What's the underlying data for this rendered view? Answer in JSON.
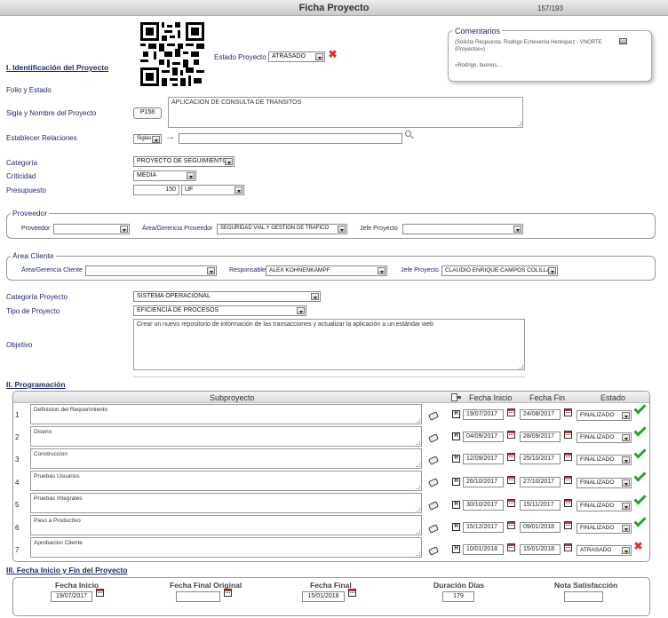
{
  "header": {
    "title": "Ficha Proyecto",
    "counter": "157/193"
  },
  "estado_proyecto": {
    "label": "Estado Proyecto",
    "value": "ATRASADO"
  },
  "comentarios": {
    "title": "Comentarios",
    "line1": "(Solicita Respuesta: Rodrigo Echeverria Henriquez - VNORTE",
    "line2": "(Proyectos»)",
    "line3": "«Rodrigo, buenos…"
  },
  "identificacion": {
    "title": "I. Identificación del Proyecto",
    "folio_label": "Folio y Estado",
    "sigla_label": "Sigla y Nombre del Proyecto",
    "sigla_value": "P158",
    "nombre_value": "APLICACION DE CONSULTA DE TRANSITOS",
    "relaciones_label": "Establecer Relaciones",
    "relaciones_select": "Siglas",
    "categoria_label": "Categoría",
    "categoria_value": "PROYECTO DE SEGUIMIENTO",
    "criticidad_label": "Criticidad",
    "criticidad_value": "MEDIA",
    "presupuesto_label": "Presupuesto",
    "presupuesto_value": "150",
    "presupuesto_unit": "UF"
  },
  "proveedor": {
    "legend": "Proveedor",
    "proveedor_label": "Proveedor",
    "area_label": "Área/Gerencia Proveedor",
    "area_value": "SEGURIDAD VIAL Y GESTION DE TRAFICO",
    "jefe_label": "Jefe Proyecto"
  },
  "area_cliente": {
    "legend": "Área Cliente",
    "area_label": "Área/Gerencia Cliente",
    "responsable_label": "Responsable",
    "responsable_value": "ALEX KOHNENKAMPF",
    "jefe_label": "Jefe Proyecto",
    "jefe_value": "CLAUDIO ENRIQUE CAMPOS COLILLAN"
  },
  "clasificacion": {
    "categoria_label": "Categoría Proyecto",
    "categoria_value": "SISTEMA OPERACIONAL",
    "tipo_label": "Tipo de Proyecto",
    "tipo_value": "EFICIENCIA DE PROCESOS",
    "objetivo_label": "Objetivo",
    "objetivo_value": "Crear un nuevo repositorio de información de las transacciones y actualizar la aplicación a un estándar web"
  },
  "programacion": {
    "title": "II. Programación",
    "headers": {
      "subproyecto": "Subproyecto",
      "inicio": "Fecha Inicio",
      "fin": "Fecha Fin",
      "estado": "Estado"
    },
    "rows": [
      {
        "n": "1",
        "name": "Definicion del Requerimiento",
        "inicio": "19/07/2017",
        "fin": "24/08/2017",
        "estado": "FINALIZADO",
        "ok": true
      },
      {
        "n": "2",
        "name": "Diseno",
        "inicio": "04/09/2017",
        "fin": "28/09/2017",
        "estado": "FINALIZADO",
        "ok": true
      },
      {
        "n": "3",
        "name": "Construccion",
        "inicio": "12/09/2017",
        "fin": "25/10/2017",
        "estado": "FINALIZADO",
        "ok": true
      },
      {
        "n": "4",
        "name": "Pruebas Usuarios",
        "inicio": "26/10/2017",
        "fin": "27/10/2017",
        "estado": "FINALIZADO",
        "ok": true
      },
      {
        "n": "5",
        "name": "Pruebas Integrales",
        "inicio": "30/10/2017",
        "fin": "15/11/2017",
        "estado": "FINALIZADO",
        "ok": true
      },
      {
        "n": "6",
        "name": "Paso a Productivo",
        "inicio": "15/12/2017",
        "fin": "09/01/2018",
        "estado": "FINALIZADO",
        "ok": true
      },
      {
        "n": "7",
        "name": "Aprobacion Cliente",
        "inicio": "10/01/2018",
        "fin": "15/01/2018",
        "estado": "ATRASADO",
        "ok": false
      }
    ]
  },
  "fechas": {
    "title": "III. Fecha Inicio y Fin del Proyecto",
    "inicio_label": "Fecha Inicio",
    "inicio_value": "19/07/2017",
    "final_original_label": "Fecha Final Original",
    "final_original_value": "",
    "final_label": "Fecha Final",
    "final_value": "15/01/2018",
    "duracion_label": "Duración Días",
    "duracion_value": "179",
    "nota_label": "Nota Satisfacción",
    "nota_value": ""
  }
}
